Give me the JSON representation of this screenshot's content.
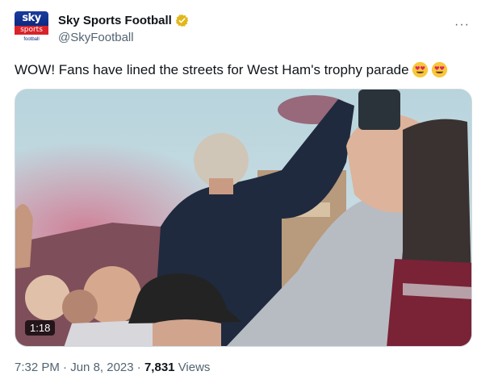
{
  "account": {
    "display_name": "Sky Sports Football",
    "handle": "@SkyFootball",
    "verified_badge_color": "#e2b719",
    "avatar_logo": {
      "line1": "sky",
      "line2": "sports",
      "line3": "football"
    }
  },
  "menu": {
    "more_label": "···"
  },
  "tweet": {
    "text": "WOW! Fans have lined the streets for West Ham's trophy parade",
    "emojis": [
      "heart-eyes-emoji",
      "heart-eyes-emoji"
    ]
  },
  "media": {
    "type": "video",
    "duration": "1:18"
  },
  "meta": {
    "time": "7:32 PM",
    "separator": "·",
    "date": "Jun 8, 2023",
    "views_count": "7,831",
    "views_label": "Views"
  },
  "colors": {
    "text_primary": "#0f1419",
    "text_secondary": "#536471",
    "border": "#cfd9de"
  }
}
